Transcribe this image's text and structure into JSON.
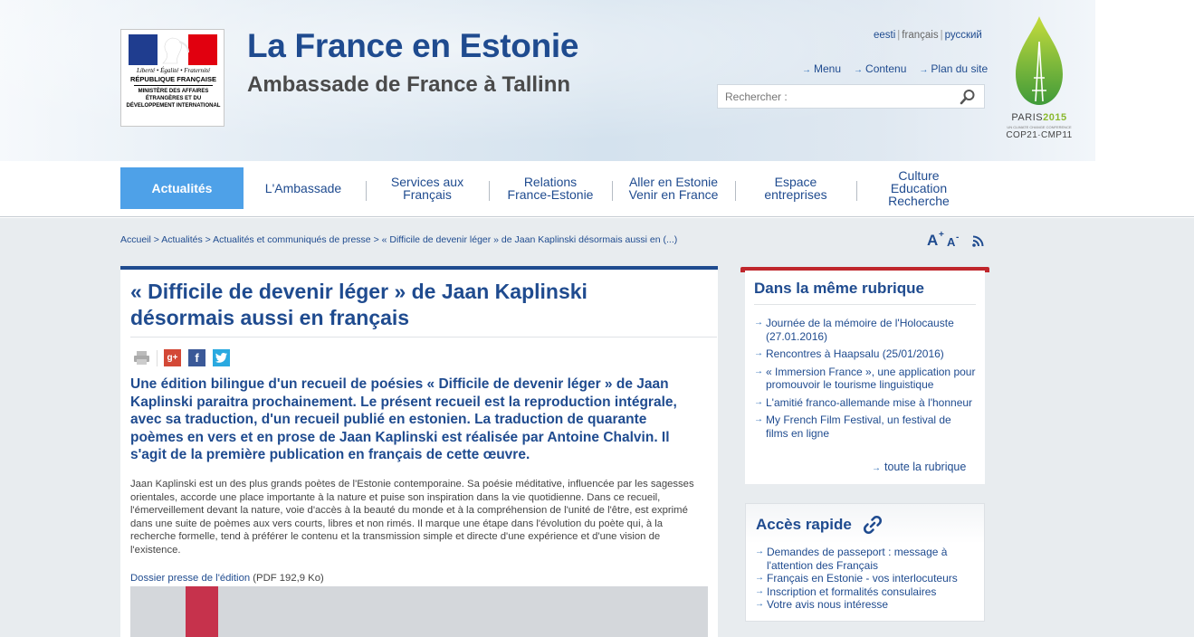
{
  "header": {
    "gov_logo": {
      "motto": "Liberté • Égalité • Fraternité",
      "republic": "RÉPUBLIQUE FRANÇAISE",
      "ministry": "MINISTÈRE DES AFFAIRES ÉTRANGÈRES ET DU DÉVELOPPEMENT INTERNATIONAL"
    },
    "title": "La France en Estonie",
    "subtitle": "Ambassade de France à Tallinn",
    "languages": [
      {
        "label": "eesti",
        "active": false
      },
      {
        "label": "français",
        "active": true
      },
      {
        "label": "русский",
        "active": false
      }
    ],
    "top_links": [
      "Menu",
      "Contenu",
      "Plan du site"
    ],
    "search": {
      "placeholder": "Rechercher :"
    },
    "cop_logo": {
      "paris": "PARIS",
      "year": "2015",
      "mini": "UN CLIMATE CHANGE CONFERENCE",
      "cop": "COP21·CMP11"
    },
    "colors": {
      "brand_blue": "#1f4b8f",
      "nav_active": "#4ea1e8",
      "accent_red": "#c0262c"
    }
  },
  "nav": {
    "items": [
      {
        "label": "Actualités",
        "active": true
      },
      {
        "label": "L'Ambassade",
        "active": false
      },
      {
        "label": "Services aux\nFrançais",
        "active": false
      },
      {
        "label": "Relations\nFrance-Estonie",
        "active": false
      },
      {
        "label": "Aller en Estonie\nVenir en France",
        "active": false
      },
      {
        "label": "Espace\nentreprises",
        "active": false
      },
      {
        "label": "Culture\nEducation\nRecherche",
        "active": false
      }
    ]
  },
  "breadcrumb": "Accueil > Actualités > Actualités et communiqués de presse > « Difficile de devenir léger » de Jaan Kaplinski désormais aussi en (...)",
  "article": {
    "title": "« Difficile de devenir léger » de Jaan Kaplinski désormais aussi en français",
    "chapo": "Une édition bilingue d'un recueil de poésies « Difficile de devenir léger » de Jaan Kaplinski paraitra prochainement. Le présent recueil est la reproduction intégrale, avec sa traduction, d'un recueil publié en estonien. La traduction de quarante poèmes en vers et en prose de Jaan Kaplinski est réalisée par Antoine Chalvin. Il s'agit de la première publication en français de cette œuvre.",
    "body": "Jaan Kaplinski est un des plus grands poètes de l'Estonie contemporaine. Sa poésie méditative, influencée par les sagesses orientales, accorde une place importante à la nature et puise son inspiration dans la vie quotidienne. Dans ce recueil, l'émerveillement devant la nature, voie d'accès à la beauté du monde et à la compréhension de l'unité de l'être, est exprimé dans une suite de poèmes aux vers courts, libres et non rimés. Il marque une étape dans l'évolution du poète qui, à la recherche formelle, tend à préférer le contenu et la transmission simple et directe d'une expérience et d'une vision de l'existence.",
    "dossier_link": "Dossier presse de l'édition",
    "dossier_meta": "(PDF 192,9 Ko)"
  },
  "sidebar": {
    "same_rubrique": {
      "title": "Dans la même rubrique",
      "items": [
        "Journée de la mémoire de l'Holocauste (27.01.2016)",
        "Rencontres à Haapsalu (25/01/2016)",
        "« Immersion France », une application pour promouvoir le tourisme linguistique",
        "L'amitié franco-allemande mise à l'honneur",
        "My French Film Festival, un festival de films en ligne"
      ],
      "more": "toute la rubrique"
    },
    "acces_rapide": {
      "title": "Accès rapide",
      "items": [
        "Demandes de passeport : message à l'attention des Français",
        "Français en Estonie - vos interlocuteurs",
        "Inscription et formalités consulaires",
        "Votre avis nous intéresse"
      ]
    }
  }
}
